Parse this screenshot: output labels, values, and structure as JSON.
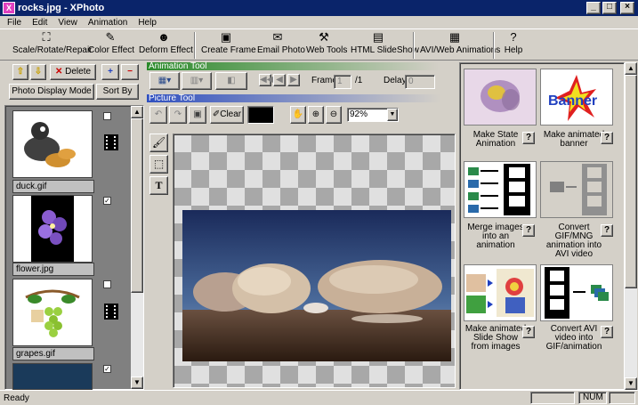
{
  "window": {
    "title": "rocks.jpg - XPhoto",
    "app_icon": "X"
  },
  "menu": [
    "File",
    "Edit",
    "View",
    "Animation",
    "Help"
  ],
  "toolbar": {
    "scale": "Scale/Rotate/Repair",
    "color": "Color Effect",
    "deform": "Deform Effect",
    "frame": "Create Frame",
    "email": "Email Photo",
    "webtools": "Web Tools",
    "slideshow": "HTML SlideShow",
    "avi": "AVI/Web Animations",
    "help": "Help"
  },
  "left": {
    "delete": "Delete",
    "display_mode": "Photo Display Mode",
    "sort": "Sort By",
    "items": [
      {
        "name": "duck.gif",
        "checked": "",
        "animated": true
      },
      {
        "name": "flower.jpg",
        "checked": "✓",
        "animated": false
      },
      {
        "name": "grapes.gif",
        "checked": "",
        "animated": true
      },
      {
        "name": "",
        "checked": "✓",
        "animated": false
      }
    ]
  },
  "animation_tool": {
    "header": "Animation Tool",
    "frame_label": "Frame",
    "frame_value": "1",
    "frame_total": "/1",
    "delay_label": "Delay",
    "delay_value": "0"
  },
  "picture_tool": {
    "header": "Picture Tool",
    "clear": "Clear",
    "zoom": "92%"
  },
  "right": {
    "tiles": [
      {
        "label": "Make State Animation",
        "q": "?"
      },
      {
        "label": "Make animated banner",
        "q": "?"
      },
      {
        "label": "Merge images into an animation",
        "q": "?"
      },
      {
        "label": "Convert GIF/MNG animation into AVI video",
        "q": "?"
      },
      {
        "label": "Make animated Slide Show from images",
        "q": "?"
      },
      {
        "label": "Convert AVI video into GIF/animation",
        "q": "?"
      }
    ],
    "banner_text": "Banner"
  },
  "status": {
    "text": "Ready",
    "num": "NUM"
  },
  "colors": {
    "titlebar": "#0a246a",
    "anim_header": "#2a8a2a",
    "pic_header": "#3050c0",
    "face": "#d4d0c8"
  }
}
